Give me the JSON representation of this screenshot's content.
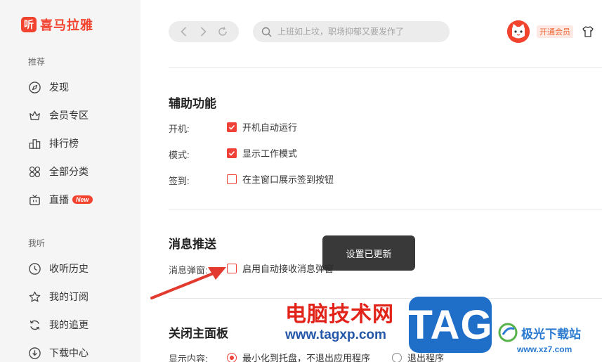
{
  "app": {
    "logo_glyph": "听",
    "logo_text": "喜马拉雅",
    "brand_color": "#f2432f"
  },
  "sidebar": {
    "section_recommend": "推荐",
    "recommend_items": [
      {
        "label": "发现",
        "icon": "compass-icon"
      },
      {
        "label": "会员专区",
        "icon": "crown-icon"
      },
      {
        "label": "排行榜",
        "icon": "ranking-icon"
      },
      {
        "label": "全部分类",
        "icon": "grid-icon"
      },
      {
        "label": "直播",
        "icon": "tv-icon",
        "badge": "New"
      }
    ],
    "section_mine": "我听",
    "mine_items": [
      {
        "label": "收听历史",
        "icon": "clock-icon"
      },
      {
        "label": "我的订阅",
        "icon": "star-icon"
      },
      {
        "label": "我的追更",
        "icon": "refresh-icon"
      },
      {
        "label": "下载中心",
        "icon": "download-icon"
      }
    ]
  },
  "topbar": {
    "search_placeholder": "上班如上坟，职场抑郁又要发作了",
    "vip_label": "开通会员"
  },
  "settings": {
    "assist": {
      "title": "辅助功能",
      "boot_label": "开机:",
      "boot_option": "开机自动运行",
      "boot_checked": true,
      "mode_label": "模式:",
      "mode_option": "显示工作模式",
      "mode_checked": true,
      "checkin_label": "签到:",
      "checkin_option": "在主窗口展示签到按钮",
      "checkin_checked": false
    },
    "push": {
      "title": "消息推送",
      "popup_label": "消息弹窗:",
      "popup_option": "启用自动接收消息弹窗",
      "popup_checked": false
    },
    "close": {
      "title": "关闭主面板",
      "display_label": "显示内容:",
      "option_minimize": "最小化到托盘，不退出应用程序",
      "option_exit": "退出程序",
      "selected": "minimize"
    }
  },
  "toast": {
    "message": "设置已更新"
  },
  "watermark": {
    "cn": "电脑技术网",
    "url": "www.tagxp.com",
    "tag": "TAG",
    "jg": "极光下载站",
    "jg_url": "www.xz7.com"
  },
  "colors": {
    "accent": "#f04138",
    "arrow": "#e23a2e"
  }
}
